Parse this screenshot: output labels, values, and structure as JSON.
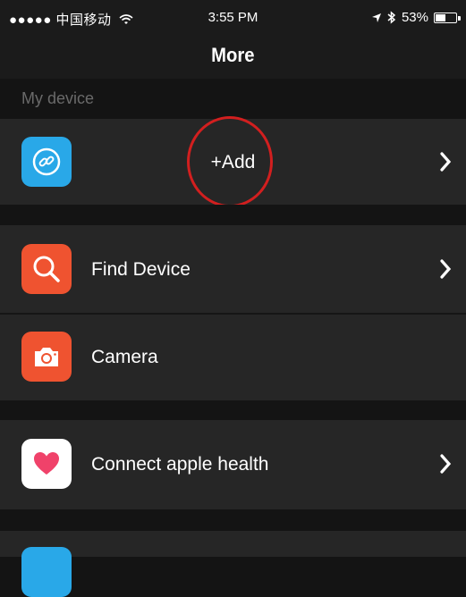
{
  "status_bar": {
    "carrier": "●●●●● 中国移动",
    "time": "3:55 PM",
    "battery_text": "53%",
    "battery_level": 0.53
  },
  "nav": {
    "title": "More"
  },
  "section": {
    "my_device": "My device"
  },
  "rows": {
    "add": {
      "label": "+Add",
      "icon": "link-icon",
      "color": "#29a8e8"
    },
    "find_device": {
      "label": "Find Device",
      "icon": "search-icon",
      "color": "#ef5330"
    },
    "camera": {
      "label": "Camera",
      "icon": "camera-icon",
      "color": "#ef5330"
    },
    "apple_health": {
      "label": "Connect apple health",
      "icon": "heart-icon",
      "color": "#ffffff"
    },
    "next": {
      "icon": "app-icon",
      "color": "#29a8e8"
    }
  },
  "colors": {
    "background": "#141414",
    "row": "#262626",
    "highlight": "#d21f1f"
  }
}
